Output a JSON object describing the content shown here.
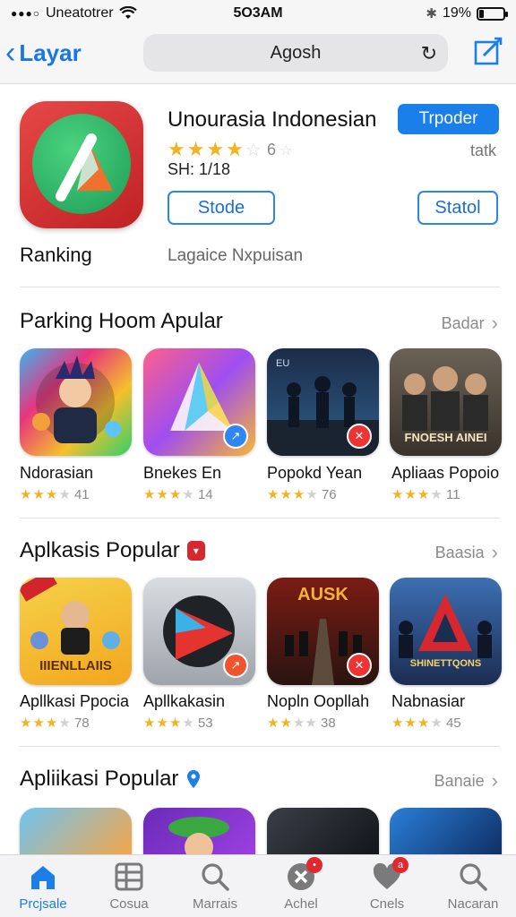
{
  "status_bar": {
    "carrier": "Uneatotrer",
    "time": "5O3AM",
    "battery": "19%",
    "battery_level": 0.19
  },
  "nav": {
    "back_label": "Layar",
    "search_text": "Agosh"
  },
  "app": {
    "title": "Unourasia Indonesian",
    "rating_count": "6",
    "size": "SH: 1/18",
    "primary_button": "Trpoder",
    "meta_right": "tatk",
    "button_left": "Stode",
    "button_right": "Statol",
    "ranking_label": "Ranking",
    "ranking_sub": "Lagaice Nxpuisan"
  },
  "sections": [
    {
      "title": "Parking Hoom Apular",
      "see_all": "Badar",
      "items": [
        {
          "name": "Ndorasian",
          "rating": "41"
        },
        {
          "name": "Bnekes En",
          "rating": "14"
        },
        {
          "name": "Popokd Yean",
          "rating": "76"
        },
        {
          "name": "Apliaas Popoio",
          "rating": "11"
        }
      ]
    },
    {
      "title": "Aplkasis Popular",
      "see_all": "Baasia",
      "items": [
        {
          "name": "Apllkasi Ppocia",
          "rating": "78"
        },
        {
          "name": "Apllkakasin",
          "rating": "53"
        },
        {
          "name": "Nopln Oopllah",
          "rating": "38"
        },
        {
          "name": "Nabnasiar",
          "rating": "45"
        }
      ]
    },
    {
      "title": "Apliikasi Popular",
      "see_all": "Banaie",
      "items": []
    }
  ],
  "tile_art_text": {
    "s1_4": "FNOESH AINEI",
    "s2_1": "IIIENLLAIIS",
    "s2_3": "AUSK",
    "s2_4": "SHINETTQONS",
    "s1_3": "EU"
  },
  "tabs": [
    {
      "label": "Prcjsale",
      "icon": "home-icon"
    },
    {
      "label": "Cosua",
      "icon": "grid-icon"
    },
    {
      "label": "Marrais",
      "icon": "search-icon"
    },
    {
      "label": "Achel",
      "icon": "close-circle-icon",
      "badge": "•"
    },
    {
      "label": "Cnels",
      "icon": "heart-icon",
      "badge": "a"
    },
    {
      "label": "Nacaran",
      "icon": "search-icon"
    }
  ],
  "colors": {
    "accent": "#1a7fe8",
    "star": "#f2b320",
    "badge": "#e0282d"
  }
}
